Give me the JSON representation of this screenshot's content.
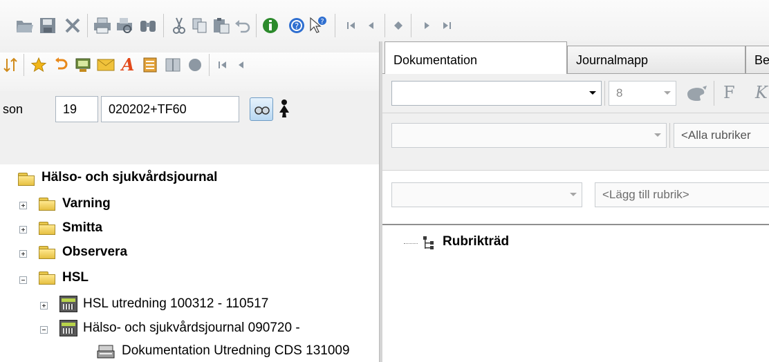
{
  "colors": {
    "panel_bg": "#f0f0f0",
    "folder_yellow": "#ffe88f",
    "info_green": "#2c8a2c",
    "help_blue": "#2f6fd0",
    "nav_gray": "#7d8a96"
  },
  "toolbar_top": {
    "icons": [
      "open-folder-icon",
      "save-icon",
      "delete-icon",
      "print-icon",
      "print-preview-icon",
      "find-icon",
      "cut-icon",
      "copy-icon",
      "paste-icon",
      "undo-icon",
      "info-icon",
      "help-icon",
      "whats-this-icon",
      "first-record-icon",
      "previous-record-icon",
      "current-record-icon",
      "next-record-icon",
      "last-record-icon"
    ]
  },
  "toolbar_left": {
    "icons": [
      "sort-icon",
      "favorite-star-icon",
      "return-icon",
      "computer-icon",
      "mail-icon",
      "signature-icon",
      "notes-icon",
      "book-icon",
      "record-dot-icon",
      "first-icon",
      "previous-icon"
    ]
  },
  "person": {
    "label": "son",
    "century": "19",
    "id_value": "020202+TF60"
  },
  "tree": {
    "root": "Hälso- och sjukvårdsjournal",
    "folders": [
      "Varning",
      "Smitta",
      "Observera",
      "HSL"
    ],
    "hsl_children": [
      "HSL utredning 100312 - 110517",
      "Hälso- och sjukvårdsjournal 090720 -"
    ],
    "document": "Dokumentation Utredning CDS 131009"
  },
  "tabs": [
    {
      "label": "Dokumentation",
      "active": true
    },
    {
      "label": "Journalmapp",
      "active": false
    },
    {
      "label": "Be",
      "active": false
    }
  ],
  "format_bar": {
    "font_value": "",
    "size_value": "8",
    "bold_label": "F",
    "italic_label": "K"
  },
  "filter_bar": {
    "filter_value": "",
    "headings_value": "<Alla rubriker"
  },
  "add_bar": {
    "template_value": "",
    "add_heading_placeholder": "<Lägg till rubrik>"
  },
  "outline": {
    "root": "Rubrikträd"
  }
}
